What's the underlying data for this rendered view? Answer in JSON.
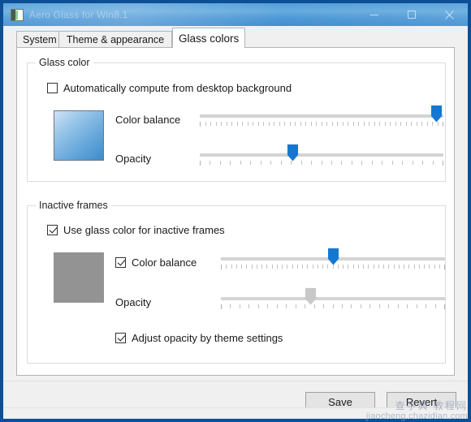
{
  "window": {
    "title": "Aero Glass for Win8.1",
    "icon": "app-icon",
    "controls": {
      "minimize": "minimize-icon",
      "maximize": "maximize-icon",
      "close": "close-icon"
    }
  },
  "tabs": [
    {
      "label": "System",
      "active": false
    },
    {
      "label": "Theme & appearance",
      "active": false
    },
    {
      "label": "Glass colors",
      "active": true
    }
  ],
  "groups": {
    "glass_color": {
      "legend": "Glass color",
      "auto_compute": {
        "label": "Automatically compute from desktop background",
        "checked": false
      },
      "swatch_color": "#6aaadd",
      "color_balance": {
        "label": "Color balance",
        "value": 97,
        "thumb_color": "#1478d2",
        "enabled": true
      },
      "opacity": {
        "label": "Opacity",
        "value": 38,
        "thumb_color": "#1478d2",
        "enabled": true
      }
    },
    "inactive_frames": {
      "legend": "Inactive frames",
      "use_glass_color": {
        "label": "Use glass color for inactive frames",
        "checked": true
      },
      "swatch_color": "#939393",
      "color_balance": {
        "label": "Color balance",
        "checked": true,
        "value": 50,
        "thumb_color": "#1478d2",
        "enabled": true
      },
      "opacity": {
        "label": "Opacity",
        "value": 40,
        "thumb_color": "#c8c8c8",
        "enabled": false
      },
      "adjust_opacity": {
        "label": "Adjust opacity by theme settings",
        "checked": true
      }
    }
  },
  "footer": {
    "save_label": "Save",
    "revert_label": "Revert"
  },
  "watermark": {
    "cn": "查字典 教程网",
    "url": "jiaocheng.chazidian.com"
  }
}
